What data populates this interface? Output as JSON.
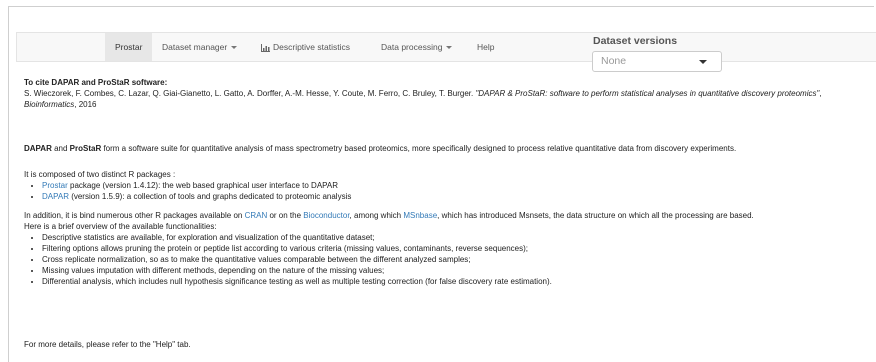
{
  "navbar": {
    "brand": "Prostar",
    "dataset_manager": "Dataset manager",
    "descriptive_statistics": "Descriptive statistics",
    "data_processing": "Data processing",
    "help": "Help"
  },
  "dataset_versions": {
    "title": "Dataset versions",
    "selected": "None"
  },
  "cite": {
    "heading": "To cite DAPAR and ProStaR software:",
    "authors": "S. Wieczorek, F. Combes, C. Lazar, Q. Giai-Gianetto, L. Gatto, A. Dorffer, A.-M. Hesse, Y. Coute, M. Ferro, C. Bruley, T. Burger. ",
    "title_italic": "\"DAPAR & ProStaR: software to perform statistical analyses in quantitative discovery proteomics\"",
    "journal_sep": ", ",
    "journal": "Bioinformatics",
    "year": ", 2016"
  },
  "intro": {
    "dapar": "DAPAR",
    "and": " and ",
    "prostar": "ProStaR",
    "rest": " form a software suite for quantitative analysis of mass spectrometry based proteomics, more specifically designed to process relative quantitative data from discovery experiments."
  },
  "composed": {
    "heading": "It is composed of two distinct R packages :",
    "items": [
      {
        "link": "Prostar",
        "text": " package (version 1.4.12): the web based graphical user interface to DAPAR"
      },
      {
        "link": "DAPAR",
        "text": " (version 1.5.9): a collection of tools and graphs dedicated to proteomic analysis"
      }
    ]
  },
  "addition": {
    "part1": "In addition, it is bind numerous other R packages available on ",
    "cran": "CRAN",
    "part2": " or on the ",
    "bioconductor": "Bioconductor",
    "part3": ", among which ",
    "msnbase": "MSnbase",
    "part4": ", which has introduced Msnsets, the data structure on which all the processing are based.",
    "overview": "Here is a brief overview of the available functionalities:"
  },
  "functionalities": [
    "Descriptive statistics are available, for exploration and visualization of the quantitative dataset;",
    "Filtering options allows pruning the protein or peptide list according to various criteria (missing values, contaminants, reverse sequences);",
    "Cross replicate normalization, so as to make the quantitative values comparable between the different analyzed samples;",
    "Missing values imputation with different methods, depending on the nature of the missing values;",
    "Differential analysis, which includes null hypothesis significance testing as well as multiple testing correction (for false discovery rate estimation)."
  ],
  "footer": "For more details, please refer to the \"Help\" tab.",
  "colors": {
    "link": "#337ab7",
    "navbar_bg": "#f8f8f8",
    "active_tab_bg": "#e7e7e7"
  }
}
